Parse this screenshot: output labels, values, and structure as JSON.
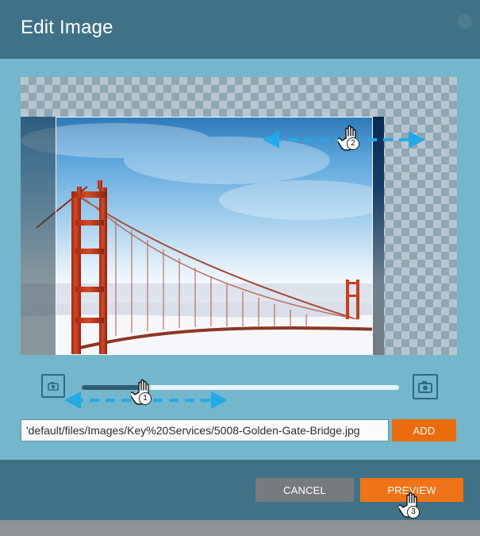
{
  "dialog": {
    "title": "Edit Image",
    "close_icon": "close-icon"
  },
  "editor": {
    "image_subject": "Golden Gate Bridge photo",
    "zoom": {
      "level": 0.2,
      "min_icon": "camera-icon",
      "max_icon": "camera-icon"
    }
  },
  "url_field": {
    "value": "'default/files/Images/Key%20Services/5008-Golden-Gate-Bridge.jpg",
    "add_label": "ADD"
  },
  "footer": {
    "cancel_label": "CANCEL",
    "preview_label": "PREVIEW"
  },
  "annotations": {
    "step_1": "1",
    "step_2": "2",
    "step_3": "3"
  },
  "colors": {
    "header": "#3f7287",
    "body": "#74b7cc",
    "accent": "#eb6b0f",
    "muted_button": "#777b7f",
    "arrow": "#23a8e8"
  }
}
